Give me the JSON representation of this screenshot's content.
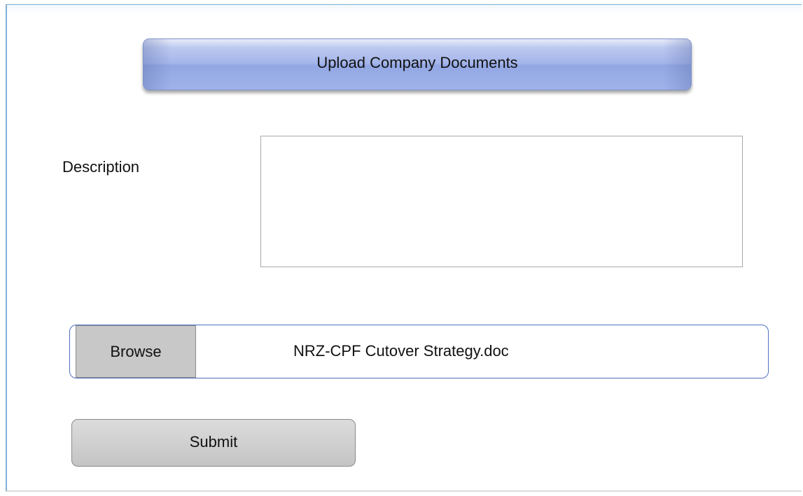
{
  "header": {
    "title": "Upload Company Documents"
  },
  "form": {
    "description_label": "Description",
    "description_value": "",
    "browse_label": "Browse",
    "selected_file": "NRZ-CPF Cutover Strategy.doc",
    "submit_label": "Submit"
  },
  "colors": {
    "banner_fill": "#a4b5ea",
    "banner_border": "#7d92c9",
    "file_row_border": "#4f6fc0",
    "button_fill": "#c8c8c8",
    "frame_border": "#7fb0d8"
  }
}
